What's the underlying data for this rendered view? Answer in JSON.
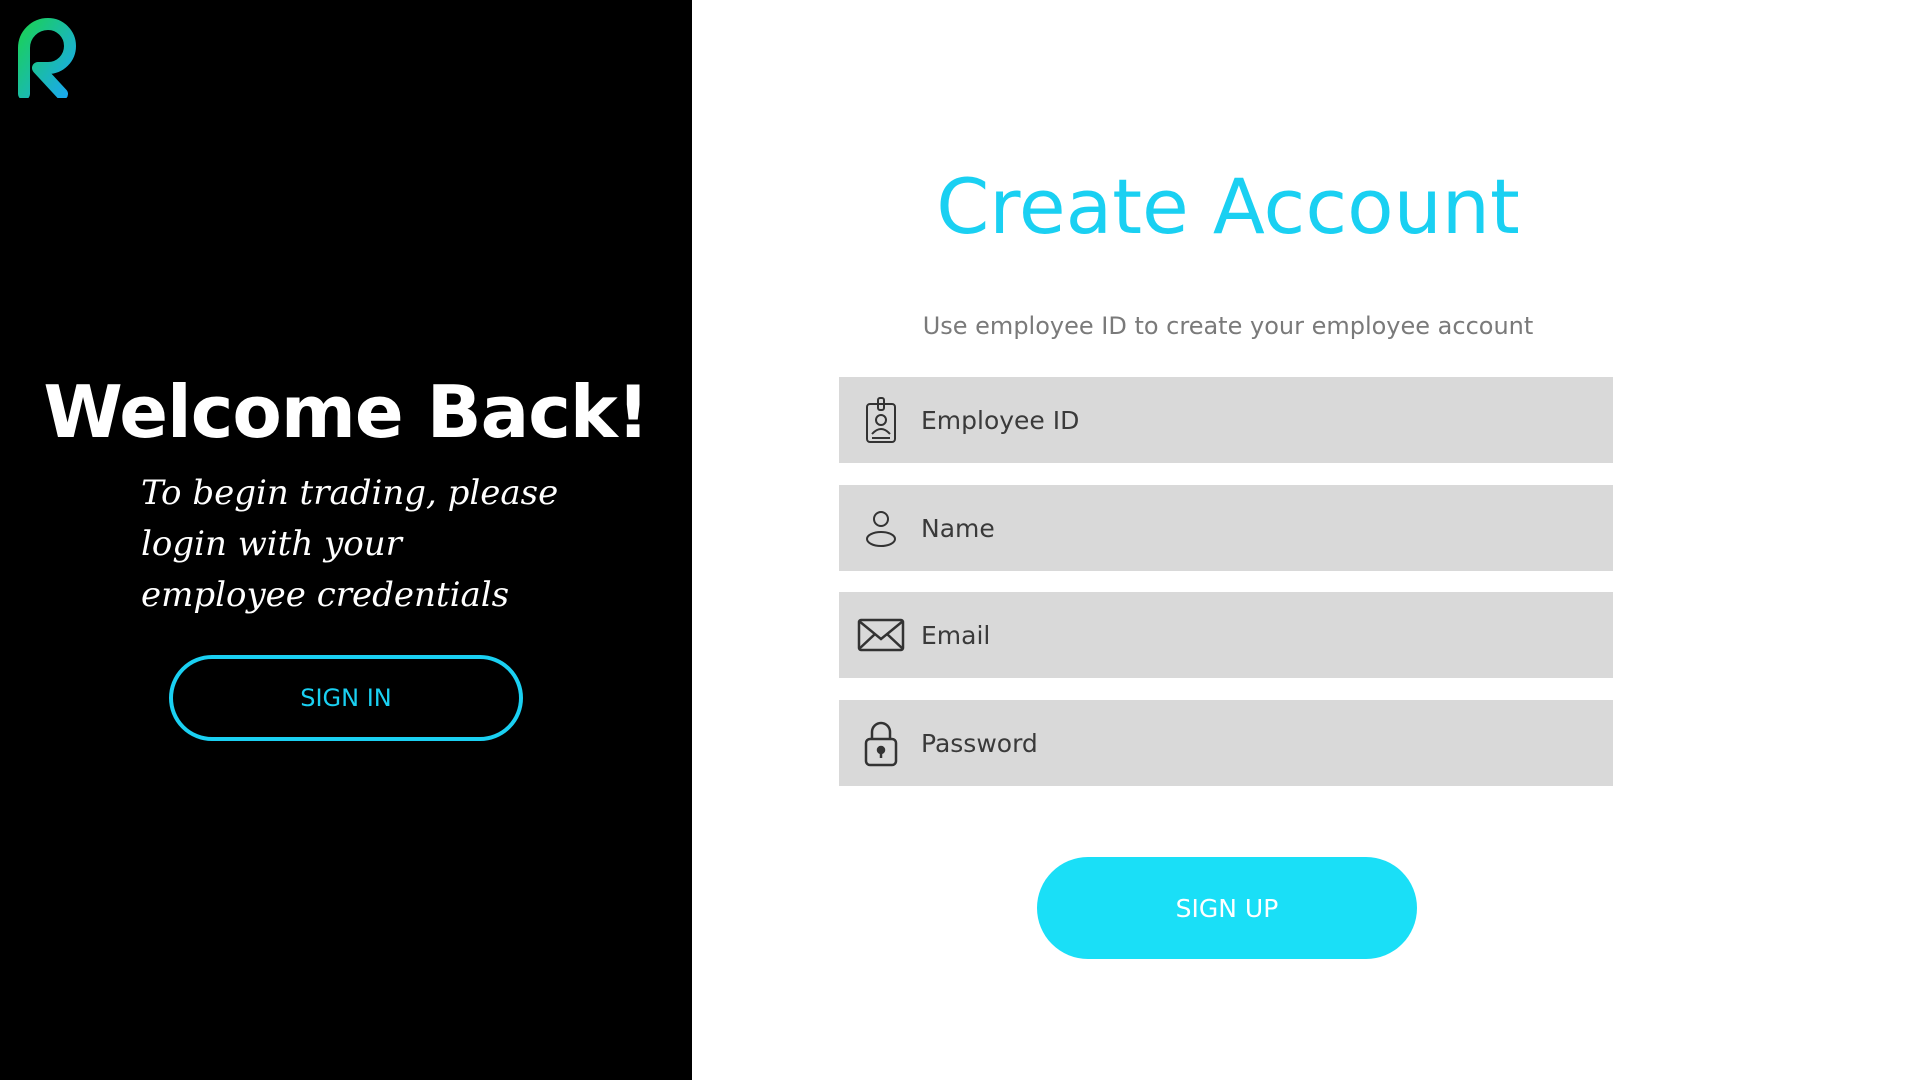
{
  "left_panel": {
    "logo_icon": "r-logo-icon",
    "title": "Welcome Back!",
    "subtitle": "To begin trading, please login with your employee credentials",
    "signin_label": "SIGN IN"
  },
  "right_panel": {
    "title": "Create Account",
    "subtitle": "Use employee ID to create your employee account",
    "fields": [
      {
        "placeholder": "Employee ID",
        "icon": "id-badge-icon"
      },
      {
        "placeholder": "Name",
        "icon": "user-icon"
      },
      {
        "placeholder": "Email",
        "icon": "envelope-icon"
      },
      {
        "placeholder": "Password",
        "icon": "lock-icon"
      }
    ],
    "signup_label": "SIGN UP"
  },
  "colors": {
    "accent": "#1ad0f2",
    "signup_fill": "#1adff7",
    "left_background": "#000000",
    "field_background": "#d9d9d9",
    "logo_gradient_start": "#1ad05a",
    "logo_gradient_end": "#1aa8f2"
  }
}
